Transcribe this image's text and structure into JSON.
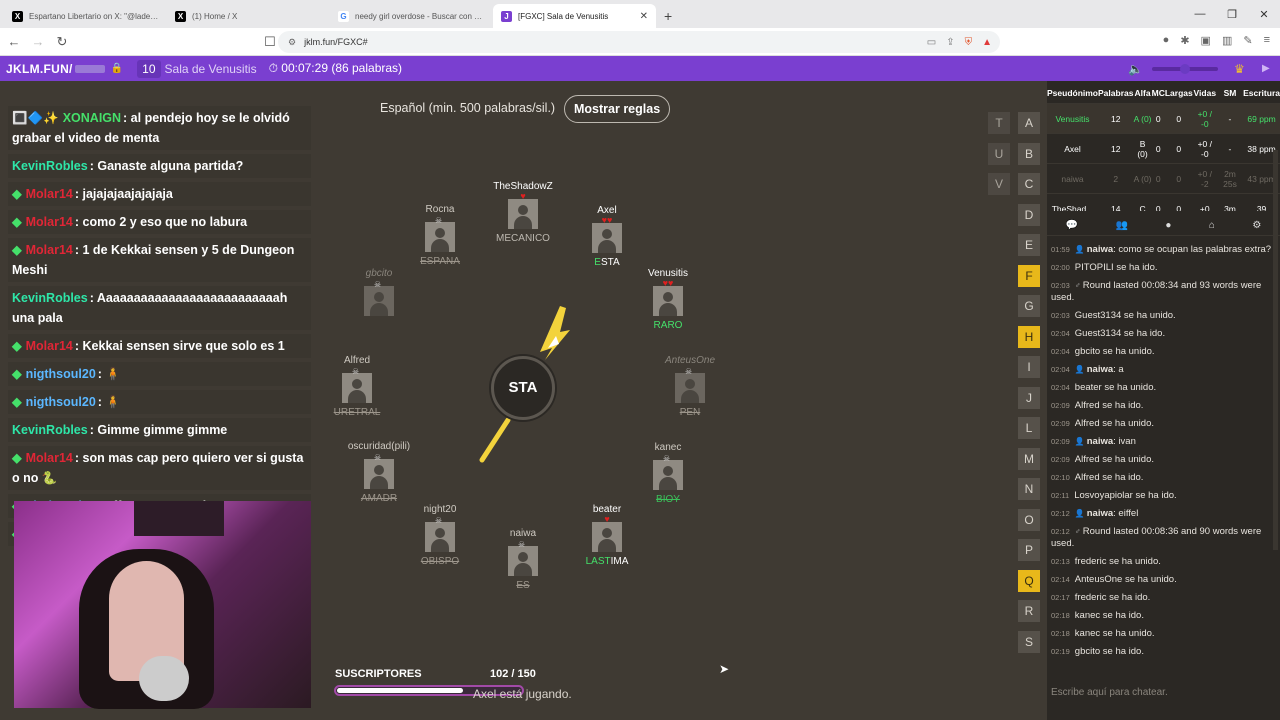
{
  "browser": {
    "tabs": [
      {
        "icon": "x-icon",
        "favcolor": "#000000",
        "title": "Espartano Libertario on X: \"@ladere...",
        "active": false
      },
      {
        "icon": "x-icon",
        "favcolor": "#000000",
        "title": "(1) Home / X",
        "active": false
      },
      {
        "icon": "google-icon",
        "favcolor": "#ffffff",
        "title": "needy girl overdose - Buscar con Goo...",
        "active": false
      },
      {
        "icon": "jklm-icon",
        "favcolor": "#7a3fd0",
        "title": "[FGXC] Sala de Venusitis",
        "active": true
      }
    ],
    "new_tab": "+",
    "url": "jklm.fun/FGXC#"
  },
  "game_bar": {
    "site": "JKLM.FUN/",
    "count": "10",
    "room": "Sala de Venusitis",
    "timer": "00:07:29 (86 palabras)"
  },
  "chat": [
    {
      "name": "XONAIGN",
      "name_color": "#45e06a",
      "prefix": "🔳🔷✨",
      "text": ": al pendejo hoy se le olvidó grabar el video de menta"
    },
    {
      "name": "KevinRobles",
      "name_color": "#2ee6a8",
      "prefix": "",
      "text": ": Ganaste alguna partida?"
    },
    {
      "name": "Molar14",
      "name_color": "#e02636",
      "prefix": "◆",
      "text": ": jajajajaajajajaja"
    },
    {
      "name": "Molar14",
      "name_color": "#e02636",
      "prefix": "◆",
      "text": ": como 2 y eso que no labura"
    },
    {
      "name": "Molar14",
      "name_color": "#e02636",
      "prefix": "◆",
      "text": ": 1 de Kekkai sensen y 5 de Dungeon Meshi"
    },
    {
      "name": "KevinRobles",
      "name_color": "#2ee6a8",
      "prefix": "",
      "text": ": Aaaaaaaaaaaaaaaaaaaaaaaaaah una pala"
    },
    {
      "name": "Molar14",
      "name_color": "#e02636",
      "prefix": "◆",
      "text": ": Kekkai sensen sirve que solo es 1"
    },
    {
      "name": "nigthsoul20",
      "name_color": "#5bb7ff",
      "prefix": "◆",
      "text": ": 🧍"
    },
    {
      "name": "nigthsoul20",
      "name_color": "#5bb7ff",
      "prefix": "◆",
      "text": ": 🧍"
    },
    {
      "name": "KevinRobles",
      "name_color": "#2ee6a8",
      "prefix": "",
      "text": ": Gimme gimme gimme"
    },
    {
      "name": "Molar14",
      "name_color": "#e02636",
      "prefix": "◆",
      "text": ": son mas cap pero quiero ver si gusta o no 🐍"
    },
    {
      "name": "nigthsoul20",
      "name_color": "#5bb7ff",
      "prefix": "◆",
      "text": ": uff que temon xd"
    },
    {
      "name": "nigthsoul20",
      "name_color": "#5bb7ff",
      "prefix": "◆",
      "text": ": 🟫"
    }
  ],
  "game": {
    "language": "Español (min. 500 palabras/sil.)",
    "rules_button": "Mostrar reglas",
    "syllable": "STA",
    "players": [
      {
        "name": "TheShadowZ",
        "hearts": "♥",
        "word": "MECANICO",
        "state": "alive",
        "word_style": "plain"
      },
      {
        "name": "Axel",
        "hearts": "♥♥",
        "word_hl": "E",
        "word_rest": "STA",
        "state": "alive",
        "word_style": "hl"
      },
      {
        "name": "Venusitis",
        "hearts": "♥♥",
        "word": "RARO",
        "state": "alive",
        "word_style": "green"
      },
      {
        "name": "AnteusOne",
        "hearts": "",
        "word": "PEN",
        "state": "gone",
        "word_style": "strike"
      },
      {
        "name": "kanec",
        "hearts": "",
        "word": "BIOY",
        "state": "dead",
        "word_style": "strike-green"
      },
      {
        "name": "beater",
        "hearts": "♥",
        "word_hl": "LAST",
        "word_rest": "IMA",
        "state": "alive",
        "word_style": "hl"
      },
      {
        "name": "naiwa",
        "hearts": "",
        "word": "ES",
        "state": "dead",
        "word_style": "strike"
      },
      {
        "name": "night20",
        "hearts": "",
        "word": "OBISPO",
        "state": "dead",
        "word_style": "strike"
      },
      {
        "name": "oscuridad(pili)",
        "hearts": "",
        "word": "AMADR",
        "state": "dead",
        "word_style": "strike"
      },
      {
        "name": "Alfred",
        "hearts": "",
        "word": "URETRAL",
        "state": "dead",
        "word_style": "strike"
      },
      {
        "name": "gbcito",
        "hearts": "",
        "word": "",
        "state": "gone",
        "word_style": "strike"
      },
      {
        "name": "Rocna",
        "hearts": "",
        "word": "ESPANA",
        "state": "dead",
        "word_style": "strike"
      }
    ],
    "letters": [
      {
        "l": "T",
        "c": 0,
        "r": 0,
        "s": "dim"
      },
      {
        "l": "A",
        "c": 1,
        "r": 0,
        "s": ""
      },
      {
        "l": "U",
        "c": 0,
        "r": 1,
        "s": "dim"
      },
      {
        "l": "B",
        "c": 1,
        "r": 1,
        "s": ""
      },
      {
        "l": "V",
        "c": 0,
        "r": 2,
        "s": "dim"
      },
      {
        "l": "C",
        "c": 1,
        "r": 2,
        "s": ""
      },
      {
        "l": "D",
        "c": 1,
        "r": 3,
        "s": ""
      },
      {
        "l": "E",
        "c": 1,
        "r": 4,
        "s": ""
      },
      {
        "l": "F",
        "c": 1,
        "r": 5,
        "s": "y"
      },
      {
        "l": "G",
        "c": 1,
        "r": 6,
        "s": ""
      },
      {
        "l": "H",
        "c": 1,
        "r": 7,
        "s": "y"
      },
      {
        "l": "I",
        "c": 1,
        "r": 8,
        "s": ""
      },
      {
        "l": "J",
        "c": 1,
        "r": 9,
        "s": ""
      },
      {
        "l": "L",
        "c": 1,
        "r": 10,
        "s": ""
      },
      {
        "l": "M",
        "c": 1,
        "r": 11,
        "s": ""
      },
      {
        "l": "N",
        "c": 1,
        "r": 12,
        "s": ""
      },
      {
        "l": "O",
        "c": 1,
        "r": 13,
        "s": ""
      },
      {
        "l": "P",
        "c": 1,
        "r": 14,
        "s": ""
      },
      {
        "l": "Q",
        "c": 1,
        "r": 15,
        "s": "y"
      },
      {
        "l": "R",
        "c": 1,
        "r": 16,
        "s": ""
      },
      {
        "l": "S",
        "c": 1,
        "r": 17,
        "s": ""
      }
    ],
    "subs_label": "SUSCRIPTORES",
    "subs_count": "102  / 150",
    "subs_progress": 0.68,
    "playing_name": "Axel",
    "playing_text": " está jugando."
  },
  "scoreboard": {
    "headers": [
      "Pseudónimo",
      "Palabras",
      "Alfa",
      "MC",
      "Largas",
      "Vidas",
      "SM",
      "Escritura"
    ],
    "rows": [
      {
        "cls": "me",
        "cells": [
          "Venusitis",
          "12",
          "A (0)",
          "0",
          "0",
          "+0 / -0",
          "-",
          "69 ppm"
        ]
      },
      {
        "cls": "",
        "cells": [
          "Axel",
          "12",
          "B (0)",
          "0",
          "0",
          "+0 / -0",
          "-",
          "38 ppm"
        ]
      },
      {
        "cls": "dim",
        "cells": [
          "naiwa",
          "2",
          "A (0)",
          "0",
          "0",
          "+0 / -2",
          "2m 25s",
          "43 ppm"
        ]
      },
      {
        "cls": "",
        "cells": [
          "TheShad...",
          "14",
          "C",
          "0",
          "0",
          "+0",
          "3m",
          "39"
        ]
      }
    ]
  },
  "log": [
    {
      "t": "01:59",
      "icon": "👤",
      "name": "naiwa",
      "text": ": como se ocupan las palabras extra?"
    },
    {
      "t": "02:00",
      "icon": "",
      "name": "",
      "text": "PITOPILI se ha ido."
    },
    {
      "t": "02:03",
      "icon": "♂",
      "name": "",
      "text": "Round lasted 00:08:34 and 93 words were used."
    },
    {
      "t": "02:03",
      "icon": "",
      "name": "",
      "text": "Guest3134 se ha unido."
    },
    {
      "t": "02:04",
      "icon": "",
      "name": "",
      "text": "Guest3134 se ha ido."
    },
    {
      "t": "02:04",
      "icon": "",
      "name": "",
      "text": "gbcito se ha unido."
    },
    {
      "t": "02:04",
      "icon": "👤",
      "name": "naiwa",
      "text": ": a"
    },
    {
      "t": "02:04",
      "icon": "",
      "name": "",
      "text": "beater se ha unido."
    },
    {
      "t": "02:09",
      "icon": "",
      "name": "",
      "text": "Alfred  se ha ido."
    },
    {
      "t": "02:09",
      "icon": "",
      "name": "",
      "text": "Alfred  se ha unido."
    },
    {
      "t": "02:09",
      "icon": "👤",
      "name": "naiwa",
      "text": ": ivan"
    },
    {
      "t": "02:09",
      "icon": "",
      "name": "",
      "text": "Alfred  se ha unido."
    },
    {
      "t": "02:10",
      "icon": "",
      "name": "",
      "text": "Alfred  se ha ido."
    },
    {
      "t": "02:11",
      "icon": "",
      "name": "",
      "text": "Losvoyapiolar se ha ido."
    },
    {
      "t": "02:12",
      "icon": "👤",
      "name": "naiwa",
      "text": ": eiffel"
    },
    {
      "t": "02:12",
      "icon": "♂",
      "name": "",
      "text": "Round lasted 00:08:36 and 90 words were used."
    },
    {
      "t": "02:13",
      "icon": "",
      "name": "",
      "text": "frederic se ha unido."
    },
    {
      "t": "02:14",
      "icon": "",
      "name": "",
      "text": "AnteusOne se ha unido."
    },
    {
      "t": "02:17",
      "icon": "",
      "name": "",
      "text": "frederic se ha ido."
    },
    {
      "t": "02:18",
      "icon": "",
      "name": "",
      "text": "kanec se ha ido."
    },
    {
      "t": "02:18",
      "icon": "",
      "name": "",
      "text": "kanec se ha unido."
    },
    {
      "t": "02:19",
      "icon": "",
      "name": "",
      "text": "gbcito se ha ido."
    }
  ],
  "chat_placeholder": "Escribe aquí para chatear."
}
